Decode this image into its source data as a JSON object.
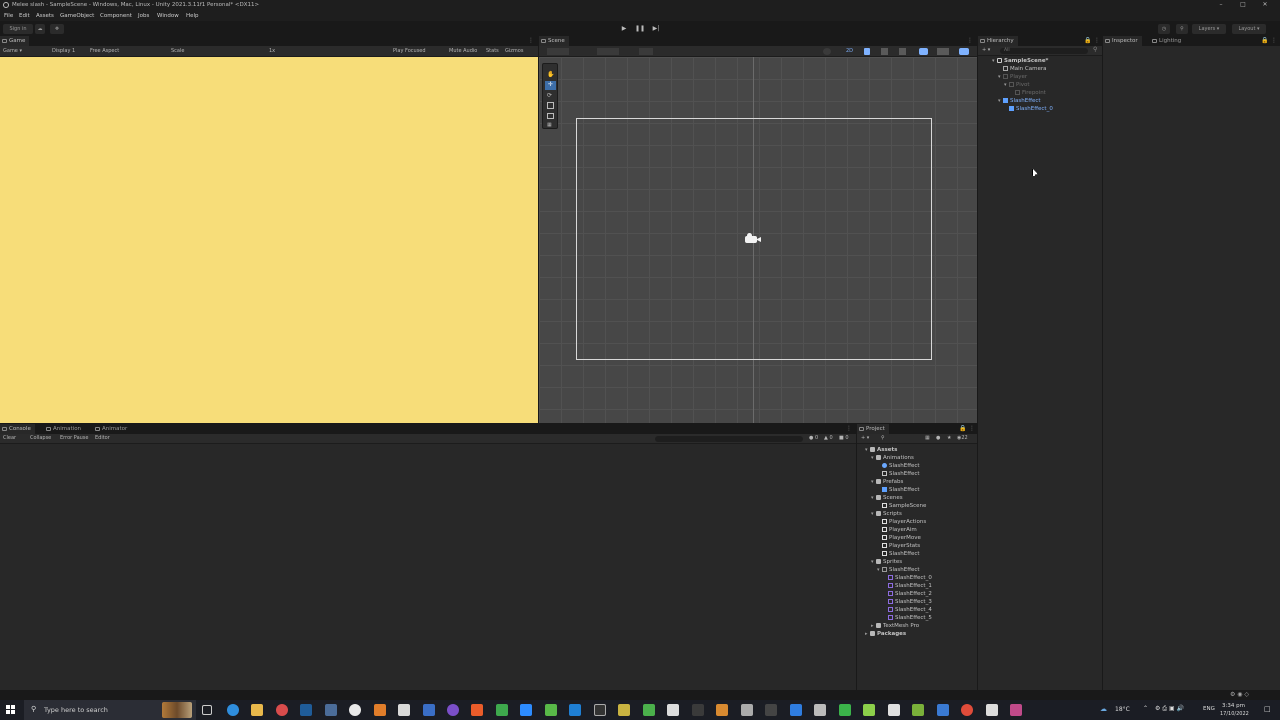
{
  "window": {
    "title": "Melee slash - SampleScene - Windows, Mac, Linux - Unity 2021.3.11f1 Personal* <DX11>"
  },
  "menu": [
    "File",
    "Edit",
    "Assets",
    "GameObject",
    "Component",
    "Jobs",
    "Window",
    "Help"
  ],
  "toolbar": {
    "sign_in": "Sign in",
    "layers": "Layers",
    "layout": "Layout"
  },
  "game_view": {
    "tab": "Game",
    "display": "Display 1",
    "aspect": "Free Aspect",
    "scale_label": "Scale",
    "scale_value": "1x",
    "play_focused": "Play Focused",
    "mute_audio": "Mute Audio",
    "stats": "Stats",
    "gizmos": "Gizmos",
    "background_color": "#f7dd79"
  },
  "scene_view": {
    "tab": "Scene",
    "mode_2d": "2D"
  },
  "hierarchy": {
    "tab": "Hierarchy",
    "search_placeholder": "All",
    "items": [
      {
        "label": "SampleScene*",
        "depth": 0,
        "state": "scene"
      },
      {
        "label": "Main Camera",
        "depth": 1,
        "state": "normal"
      },
      {
        "label": "Player",
        "depth": 1,
        "state": "dim"
      },
      {
        "label": "Pivot",
        "depth": 2,
        "state": "dim"
      },
      {
        "label": "Firepoint",
        "depth": 3,
        "state": "dim"
      },
      {
        "label": "SlashEffect",
        "depth": 1,
        "state": "prefab"
      },
      {
        "label": "SlashEffect_0",
        "depth": 2,
        "state": "prefab"
      }
    ]
  },
  "inspector": {
    "tab": "Inspector",
    "tab2": "Lighting"
  },
  "console": {
    "tabs": [
      "Console",
      "Animation",
      "Animator"
    ],
    "clear": "Clear",
    "collapse": "Collapse",
    "error_pause": "Error Pause",
    "editor": "Editor",
    "count_log": "0",
    "count_warn": "0",
    "count_err": "0"
  },
  "project": {
    "tab": "Project",
    "count": "22",
    "items": [
      {
        "label": "Assets",
        "depth": 0,
        "type": "folder"
      },
      {
        "label": "Animations",
        "depth": 1,
        "type": "folder"
      },
      {
        "label": "SlashEffect",
        "depth": 2,
        "type": "anim"
      },
      {
        "label": "SlashEffect",
        "depth": 2,
        "type": "controller"
      },
      {
        "label": "Prefabs",
        "depth": 1,
        "type": "folder"
      },
      {
        "label": "SlashEffect",
        "depth": 2,
        "type": "prefab"
      },
      {
        "label": "Scenes",
        "depth": 1,
        "type": "folder"
      },
      {
        "label": "SampleScene",
        "depth": 2,
        "type": "scene"
      },
      {
        "label": "Scripts",
        "depth": 1,
        "type": "folder"
      },
      {
        "label": "PlayerActions",
        "depth": 2,
        "type": "script"
      },
      {
        "label": "PlayerAim",
        "depth": 2,
        "type": "script"
      },
      {
        "label": "PlayerMove",
        "depth": 2,
        "type": "script"
      },
      {
        "label": "PlayerStats",
        "depth": 2,
        "type": "script"
      },
      {
        "label": "SlashEffect",
        "depth": 2,
        "type": "script"
      },
      {
        "label": "Sprites",
        "depth": 1,
        "type": "folder"
      },
      {
        "label": "SlashEffect",
        "depth": 2,
        "type": "sprite-sheet"
      },
      {
        "label": "SlashEffect_0",
        "depth": 3,
        "type": "sprite"
      },
      {
        "label": "SlashEffect_1",
        "depth": 3,
        "type": "sprite"
      },
      {
        "label": "SlashEffect_2",
        "depth": 3,
        "type": "sprite"
      },
      {
        "label": "SlashEffect_3",
        "depth": 3,
        "type": "sprite"
      },
      {
        "label": "SlashEffect_4",
        "depth": 3,
        "type": "sprite"
      },
      {
        "label": "SlashEffect_5",
        "depth": 3,
        "type": "sprite"
      },
      {
        "label": "TextMesh Pro",
        "depth": 1,
        "type": "folder"
      },
      {
        "label": "Packages",
        "depth": 0,
        "type": "folder"
      }
    ]
  },
  "taskbar": {
    "search_placeholder": "Type here to search",
    "weather": "18°C",
    "lang": "ENG",
    "time": "3:34 pm",
    "date": "17/10/2022"
  }
}
